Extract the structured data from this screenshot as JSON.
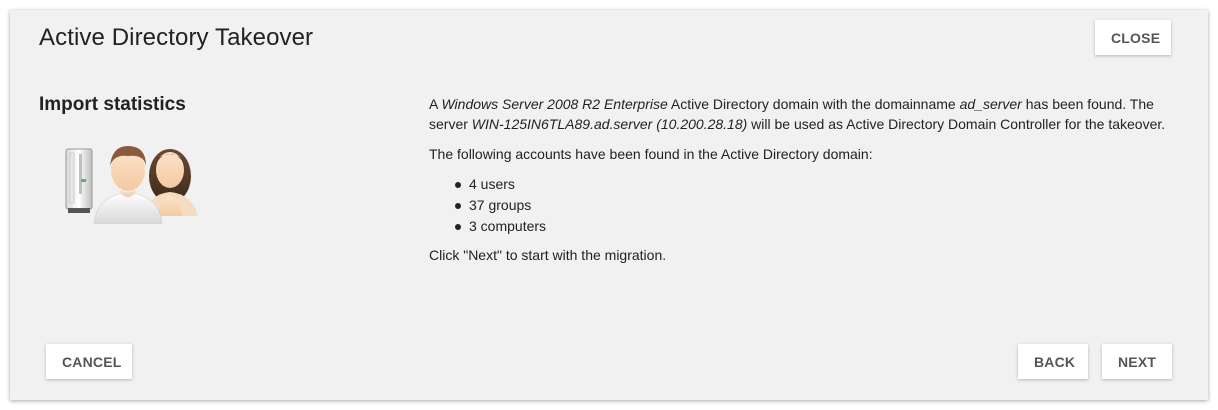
{
  "dialog": {
    "title": "Active Directory Takeover",
    "close_label": "CLOSE"
  },
  "section": {
    "title": "Import statistics",
    "illustration_icon": "users-and-server-icon"
  },
  "content": {
    "intro": {
      "t1": "A ",
      "os": "Windows Server 2008 R2 Enterprise",
      "t2": " Active Directory domain with the domainname ",
      "domain": "ad_server",
      "t3": " has been found. The server ",
      "server": "WIN-125IN6TLA89.ad.server (10.200.28.18)",
      "t4": " will be used as Active Directory Domain Controller for the takeover."
    },
    "accounts_heading": "The following accounts have been found in the Active Directory domain:",
    "accounts": [
      {
        "label": "4 users"
      },
      {
        "label": "37 groups"
      },
      {
        "label": "3 computers"
      }
    ],
    "next_hint": "Click \"Next\" to start with the migration."
  },
  "footer": {
    "cancel_label": "CANCEL",
    "back_label": "BACK",
    "next_label": "NEXT"
  },
  "colors": {
    "dialog_background": "#f1f1f1",
    "button_background": "#ffffff",
    "button_text": "#555555",
    "text": "#222222"
  }
}
